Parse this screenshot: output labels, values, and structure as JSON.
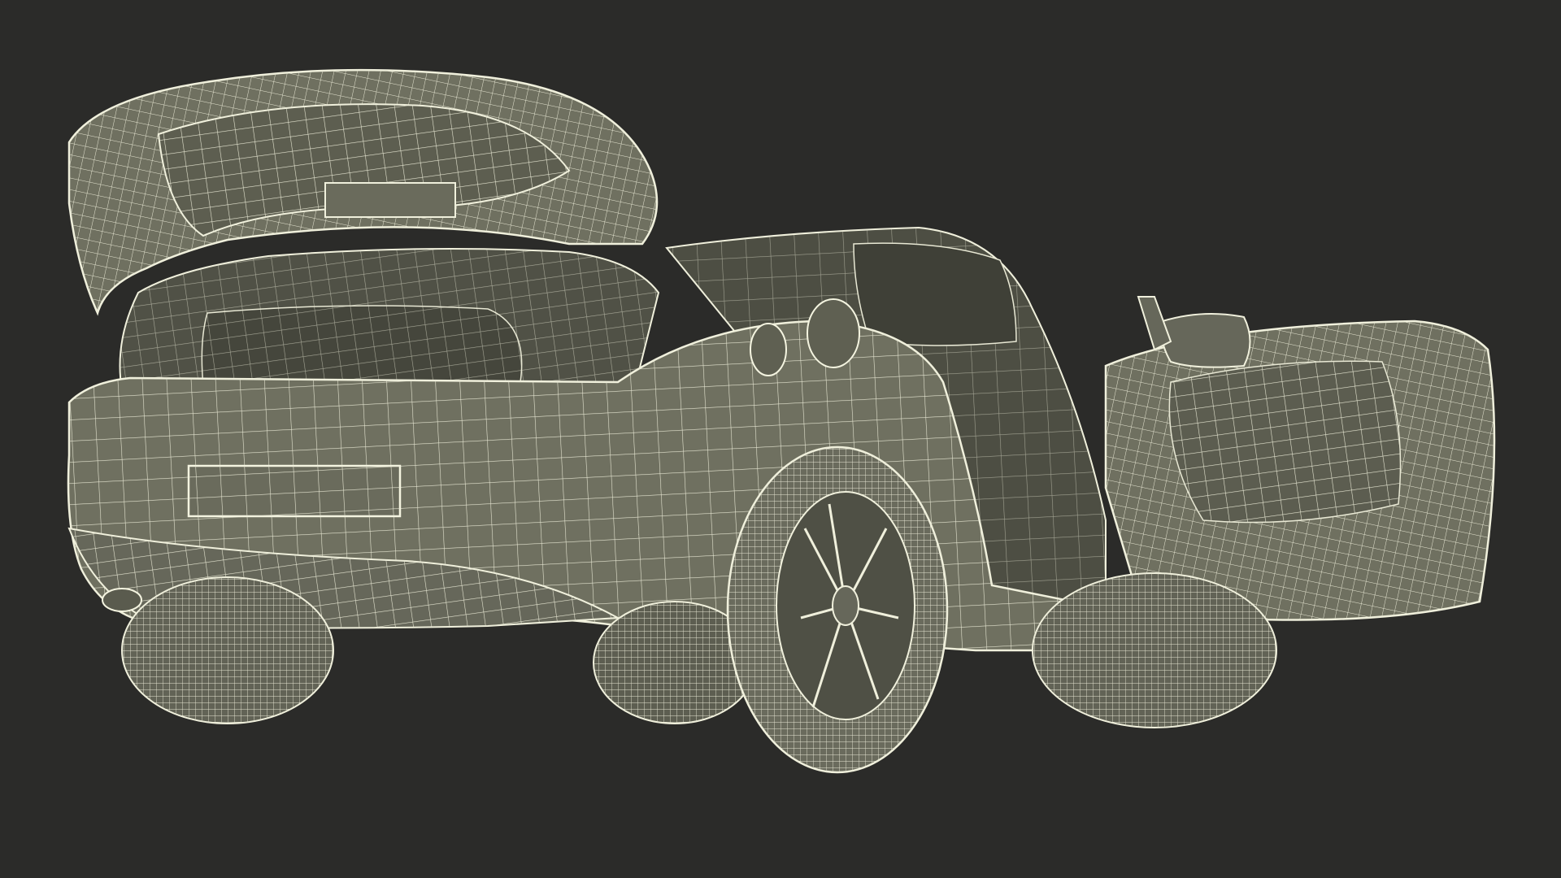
{
  "scene": {
    "background_color": "#2b2b29",
    "mesh_fill_color": "#6f7060",
    "mesh_shade_color": "#4a4b40",
    "wire_color": "#e8e8d4",
    "subject": "wireframe-car-model"
  }
}
